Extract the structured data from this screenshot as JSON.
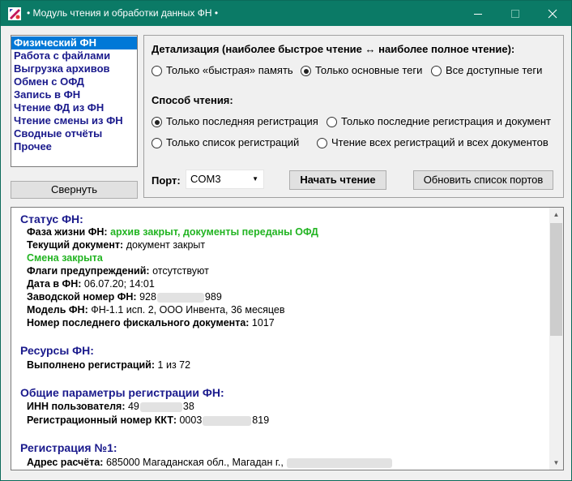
{
  "window": {
    "title": "• Модуль чтения и обработки данных ФН •"
  },
  "nav": {
    "items": [
      {
        "label": "Физический ФН",
        "selected": true
      },
      {
        "label": "Работа с файлами"
      },
      {
        "label": "Выгрузка архивов"
      },
      {
        "label": "Обмен с ОФД"
      },
      {
        "label": "Запись в ФН"
      },
      {
        "label": "Чтение ФД из ФН"
      },
      {
        "label": "Чтение смены из ФН"
      },
      {
        "label": "Сводные отчёты"
      },
      {
        "label": "Прочее"
      }
    ],
    "collapse_label": "Свернуть"
  },
  "detail": {
    "heading": "Детализация (наиболее быстрое чтение ↔ наиболее полное чтение):",
    "options": [
      {
        "label": "Только «быстрая» память",
        "checked": false
      },
      {
        "label": "Только основные теги",
        "checked": true
      },
      {
        "label": "Все доступные теги",
        "checked": false
      }
    ]
  },
  "read_mode": {
    "heading": "Способ чтения:",
    "options": [
      {
        "label": "Только последняя регистрация",
        "checked": true
      },
      {
        "label": "Только последние регистрация и документ",
        "checked": false
      },
      {
        "label": "Только список регистраций",
        "checked": false
      },
      {
        "label": "Чтение всех регистраций и всех документов",
        "checked": false
      }
    ]
  },
  "port": {
    "label": "Порт:",
    "value": "COM3"
  },
  "buttons": {
    "start": "Начать чтение",
    "refresh_ports": "Обновить список портов"
  },
  "report": {
    "status": {
      "title": "Статус ФН:",
      "life_phase_label": "Фаза жизни ФН:",
      "life_phase_value": "архив закрыт, документы переданы ОФД",
      "current_doc_label": "Текущий документ:",
      "current_doc_value": "документ закрыт",
      "shift_closed": "Смена закрыта",
      "warning_flags_label": "Флаги предупреждений:",
      "warning_flags_value": "отсутствуют",
      "date_label": "Дата в ФН:",
      "date_value": "06.07.20; 14:01",
      "serial_label": "Заводской номер ФН:",
      "serial_start": "928",
      "serial_end": "989",
      "model_label": "Модель ФН:",
      "model_value": "ФН-1.1 исп. 2, ООО Инвента, 36 месяцев",
      "last_doc_label": "Номер последнего фискального документа:",
      "last_doc_value": "1017"
    },
    "resources": {
      "title": "Ресурсы ФН:",
      "registrations_label": "Выполнено регистраций:",
      "registrations_value": "1 из 72"
    },
    "general": {
      "title": "Общие параметры регистрации ФН:",
      "inn_label": "ИНН пользователя:",
      "inn_start": "49",
      "inn_end": "38",
      "reg_label": "Регистрационный номер ККТ:",
      "reg_start": "0003",
      "reg_end": "819"
    },
    "registration1": {
      "title": "Регистрация №1:",
      "address_label": "Адрес расчёта:",
      "address_value": "685000 Магаданская обл., Магадан г.,"
    }
  },
  "colors": {
    "titlebar": "#0b7a66",
    "nav_text": "#1a1a8c",
    "selection": "#0078d7",
    "ok_green": "#22b422"
  }
}
